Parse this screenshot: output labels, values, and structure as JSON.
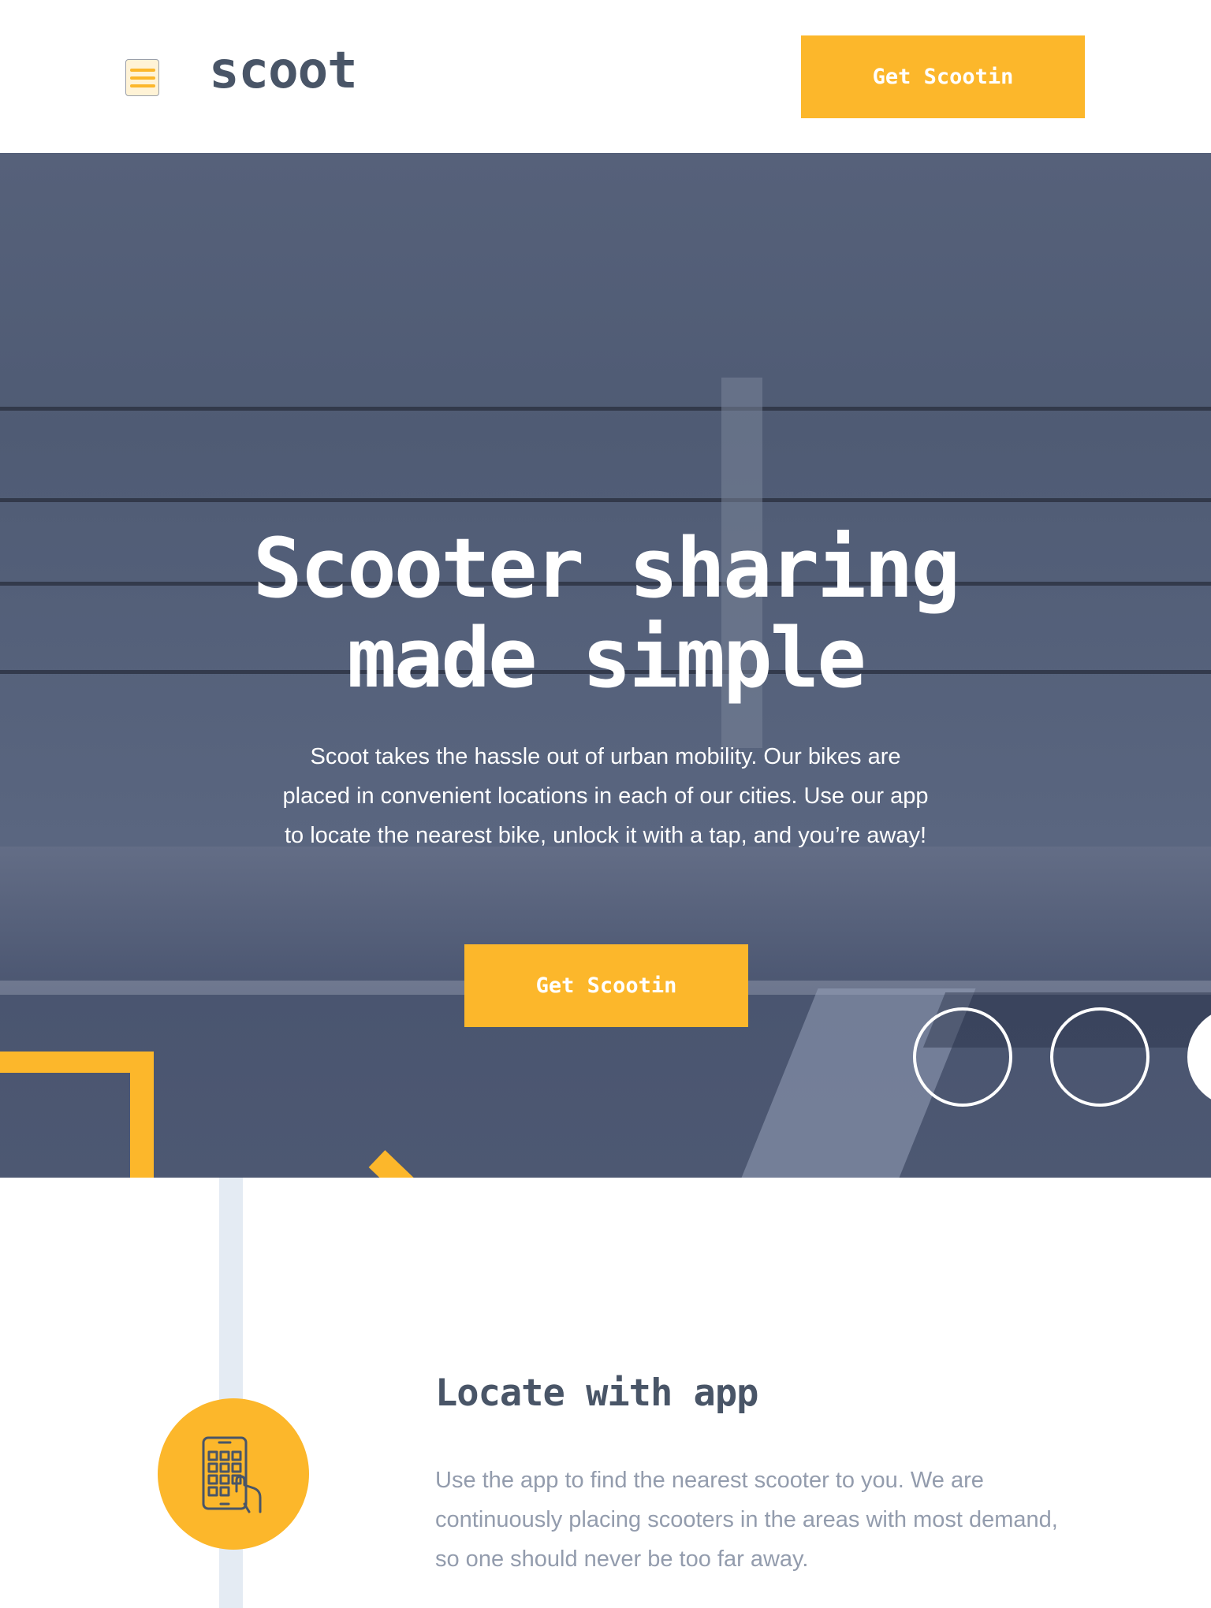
{
  "header": {
    "logo": "scoot",
    "menu_icon": "hamburger-icon",
    "cta_label": "Get Scootin"
  },
  "hero": {
    "title_line1": "Scooter sharing",
    "title_line2": "made simple",
    "description": "Scoot takes the hassle out of urban mobility. Our bikes are placed in convenient locations in each of our cities. Use our app to locate the nearest bike, unlock it with a tap, and you’re away!",
    "cta_label": "Get Scootin",
    "decor_icon": "arrow-right-icon"
  },
  "feature": {
    "title": "Locate with app",
    "description": "Use the app to find the nearest scooter to you. We are continuously placing scooters in the areas with most demand, so one should never be too far away.",
    "icon": "phone-tap-icon"
  },
  "colors": {
    "accent": "#fcb72b",
    "heading": "#495567",
    "body_text": "#939cad",
    "hero_overlay": "#56617a",
    "rail": "#e4ebf3"
  }
}
